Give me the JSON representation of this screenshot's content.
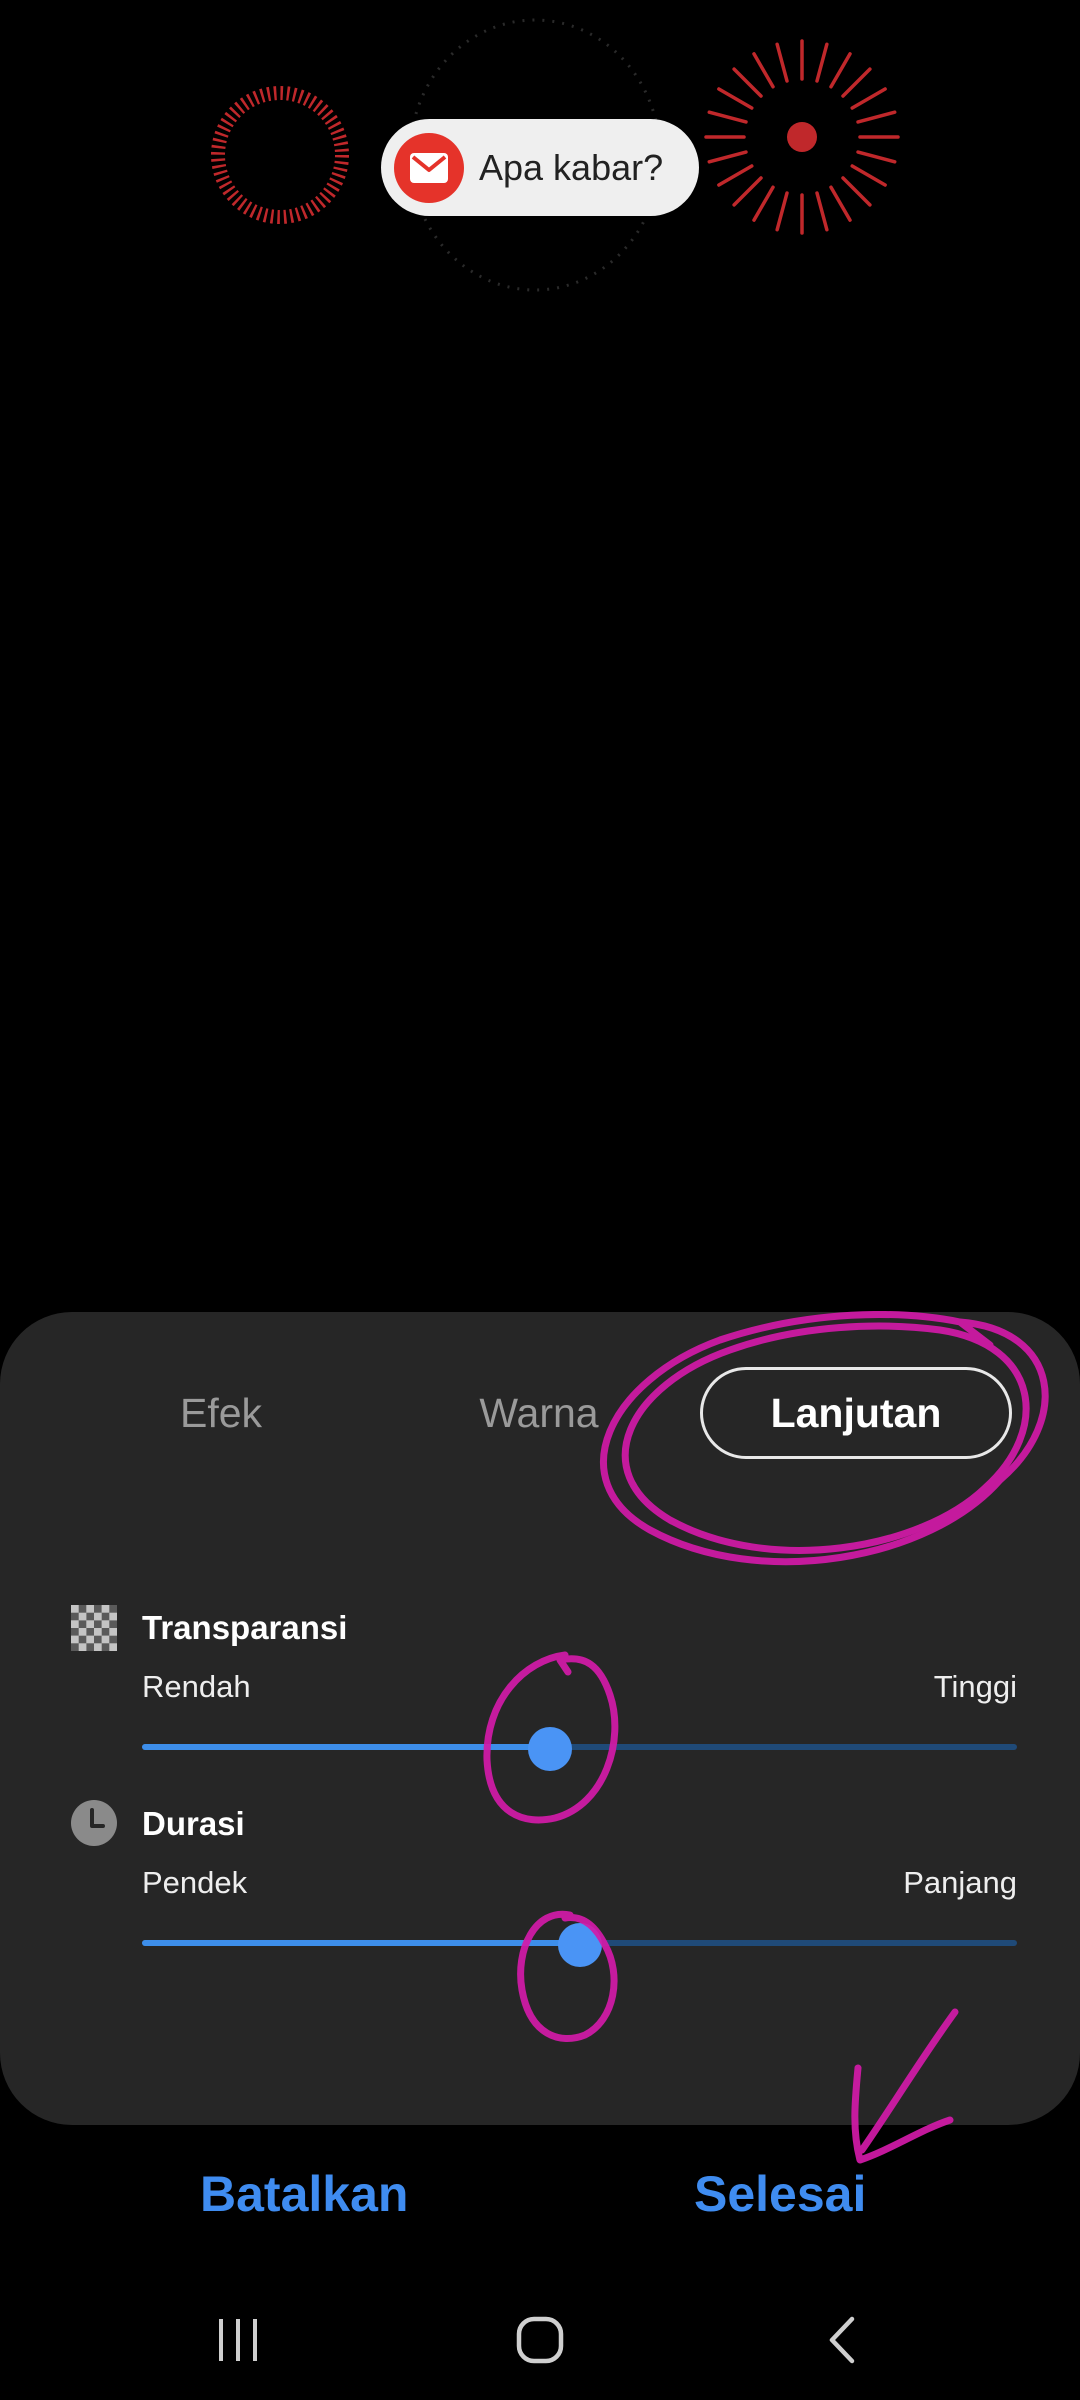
{
  "preview": {
    "notification_text": "Apa kabar?",
    "notification_icon": "email-icon",
    "accent_color": "#e5332a"
  },
  "tabs": [
    {
      "label": "Efek",
      "selected": false
    },
    {
      "label": "Warna",
      "selected": false
    },
    {
      "label": "Lanjutan",
      "selected": true
    }
  ],
  "settings": {
    "transparency": {
      "title": "Transparansi",
      "icon": "checkerboard-icon",
      "low_label": "Rendah",
      "high_label": "Tinggi",
      "value": 0.466
    },
    "duration": {
      "title": "Durasi",
      "icon": "clock-icon",
      "low_label": "Pendek",
      "high_label": "Panjang",
      "value": 0.5
    }
  },
  "actions": {
    "cancel": "Batalkan",
    "done": "Selesai",
    "color": "#3f8cf0"
  },
  "annotation_color": "#d21aa8"
}
